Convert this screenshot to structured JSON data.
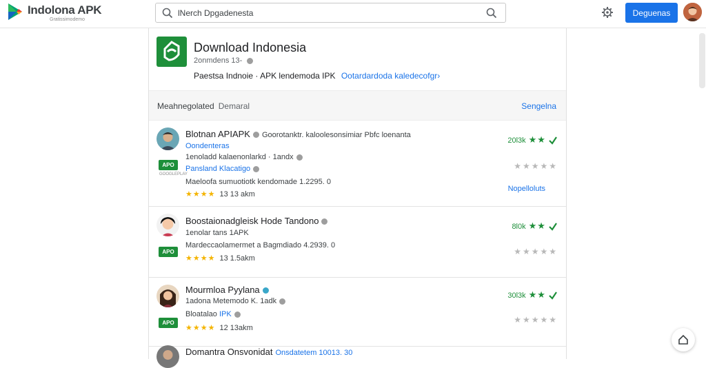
{
  "header": {
    "brand": "Indolona APK",
    "brand_sub": "Gratissimodemo",
    "search_value": "lNerch Dpgadenesta",
    "primary_button": "Deguenas"
  },
  "app": {
    "title": "Download Indonesia",
    "subtitle": "2onmdens 13-",
    "description": "Paestsa Indnoie · APK lendemoda IPK",
    "description_link": "Ootardardoda kaledecofgr›"
  },
  "section": {
    "left_label": "Meahnegolated",
    "left_label_2": "Demaral",
    "right_link": "Sengelna"
  },
  "items": [
    {
      "title": "Blotnan APIAPK",
      "title_meta": "Goorotanktr. kaloolesonsimiar Pbfc loenanta",
      "line1": "Oondenteras",
      "line2": "1enoladd kalaenonlarkd · 1andx",
      "line3": "Pansland Klacatigo",
      "line4": "Maeloofa sumuotiotk kendomade 1.2295. 0",
      "rating_text": "13 13 akm",
      "score": "20l3k",
      "badge": "APO",
      "badge_sub": "GOOGLEPLAY",
      "more": "Nopelloluts"
    },
    {
      "title": "Boostaionadgleisk Hode Tandono",
      "line1": "1enolar tans 1APK",
      "line2": "Mardeccaolamermet a Bagmdiado 4.2939. 0",
      "rating_text": "13 1.5akm",
      "score": "8l0k",
      "badge": "APO"
    },
    {
      "title": "Mourmloa Pyylana",
      "line1": "1adona Metemodo K. 1adk",
      "line2": "Bloatalao",
      "line2_link": "IPK",
      "rating_text": "12 13akm",
      "score": "30l3k",
      "badge": "APO"
    },
    {
      "title": "Domantra Onsvonidat",
      "title_meta": "Onsdatetem 10013. 30"
    }
  ],
  "colors": {
    "accent": "#1a73e8",
    "brand_green": "#1e8f3a",
    "star_yellow": "#f4b400"
  },
  "icons": [
    "play-logo-icon",
    "search-icon",
    "settings-icon",
    "check-icon",
    "verified-icon",
    "home-icon"
  ]
}
